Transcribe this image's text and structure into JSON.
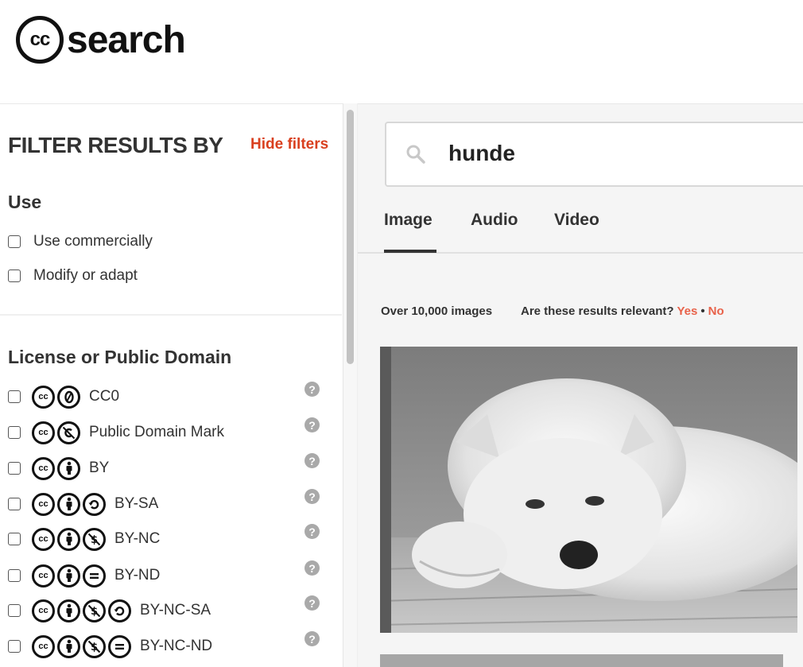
{
  "header": {
    "logo_cc": "cc",
    "logo_text": "search"
  },
  "sidebar": {
    "title": "FILTER RESULTS BY",
    "hide_filters": "Hide filters",
    "use_section": {
      "title": "Use",
      "options": [
        "Use commercially",
        "Modify or adapt"
      ]
    },
    "license_section": {
      "title": "License or Public Domain",
      "licenses": [
        {
          "label": "CC0",
          "icons": [
            "cc-icon",
            "zero-icon"
          ]
        },
        {
          "label": "Public Domain Mark",
          "icons": [
            "cc-icon",
            "public-domain-icon"
          ]
        },
        {
          "label": "BY",
          "icons": [
            "cc-icon",
            "by-icon"
          ]
        },
        {
          "label": "BY-SA",
          "icons": [
            "cc-icon",
            "by-icon",
            "sa-icon"
          ]
        },
        {
          "label": "BY-NC",
          "icons": [
            "cc-icon",
            "by-icon",
            "nc-icon"
          ]
        },
        {
          "label": "BY-ND",
          "icons": [
            "cc-icon",
            "by-icon",
            "nd-icon"
          ]
        },
        {
          "label": "BY-NC-SA",
          "icons": [
            "cc-icon",
            "by-icon",
            "nc-icon",
            "sa-icon"
          ]
        },
        {
          "label": "BY-NC-ND",
          "icons": [
            "cc-icon",
            "by-icon",
            "nc-icon",
            "nd-icon"
          ]
        }
      ],
      "help_symbol": "?"
    }
  },
  "search": {
    "query": "hunde"
  },
  "tabs": [
    {
      "label": "Image",
      "active": true
    },
    {
      "label": "Audio",
      "active": false
    },
    {
      "label": "Video",
      "active": false
    }
  ],
  "results": {
    "count": "Over 10,000 images",
    "relevance_question": "Are these results relevant?",
    "yes": "Yes",
    "dot": "•",
    "no": "No"
  },
  "colors": {
    "accent": "#d9401f",
    "relevance_link": "#e8624a",
    "text": "#333333",
    "main_bg": "#f5f5f5"
  }
}
